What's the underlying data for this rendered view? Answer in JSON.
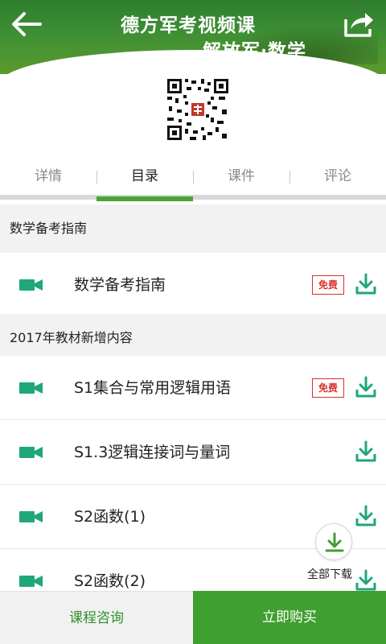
{
  "header": {
    "title_line1": "德方军考视频课",
    "title_line2": "—解放军·数学",
    "back_icon": "arrow-left-icon",
    "share_icon": "share-icon"
  },
  "tabs": [
    {
      "label": "详情",
      "active": false
    },
    {
      "label": "目录",
      "active": true
    },
    {
      "label": "课件",
      "active": false
    },
    {
      "label": "评论",
      "active": false
    }
  ],
  "sections": [
    {
      "title": "数学备考指南",
      "lessons": [
        {
          "title": "数学备考指南",
          "free": true,
          "free_label": "免费"
        }
      ]
    },
    {
      "title": "2017年教材新增内容",
      "lessons": [
        {
          "title": "S1集合与常用逻辑用语",
          "free": true,
          "free_label": "免费"
        },
        {
          "title": "S1.3逻辑连接词与量词",
          "free": false
        },
        {
          "title": "S2函数(1)",
          "free": false
        },
        {
          "title": "S2函数(2)",
          "free": false
        }
      ]
    }
  ],
  "download_all": {
    "label": "全部下载"
  },
  "bottom_bar": {
    "consult_label": "课程咨询",
    "buy_label": "立即购买"
  },
  "colors": {
    "brand_green": "#3f9f2f",
    "free_badge": "#d9302c",
    "icon_teal": "#1fa77a"
  }
}
